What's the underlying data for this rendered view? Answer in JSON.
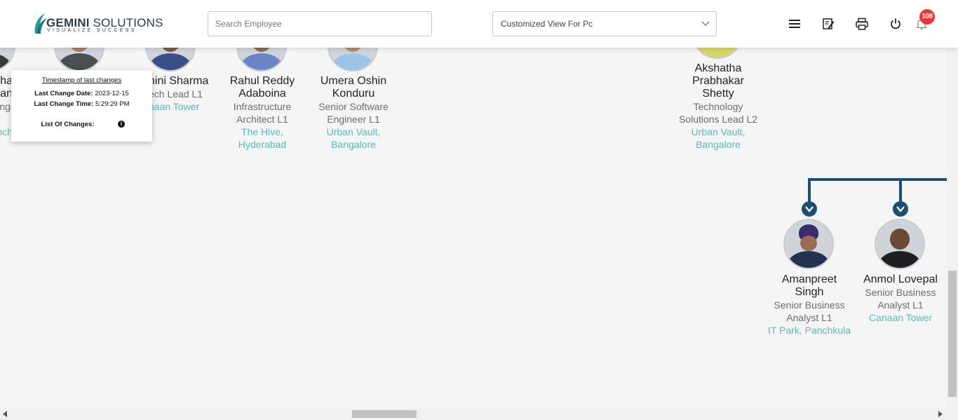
{
  "header": {
    "logo": {
      "brand_bold": "GEMINI",
      "brand_rest": " SOLUTIONS",
      "tagline": "VISUALIZE SUCCESS"
    },
    "search": {
      "placeholder": "Search Employee",
      "value": ""
    },
    "view_select": {
      "selected": "Customized View For Pc"
    },
    "icons": [
      "menu-icon",
      "edit-note-icon",
      "print-icon",
      "power-icon",
      "bell-icon"
    ],
    "notification_count": "108"
  },
  "tooltip": {
    "heading": "Timestamp of last changes",
    "date_label": "Last Change Date:",
    "date_value": "2023-12-15",
    "time_label": "Last Change Time:",
    "time_value": "5:29:29 PM",
    "changes_label": "List Of Changes:"
  },
  "partial_left": {
    "name_frag": "ha",
    "name_frag2": "an",
    "title_frag": "ngi",
    "loc_frag": "nch"
  },
  "employees": [
    {
      "name": "nini Sharma",
      "title1": "ech Lead L1",
      "loc1": "naan Tower"
    },
    {
      "name": "Rahul Reddy",
      "name2": "Adaboina",
      "title1": "Infrastructure",
      "title2": "Architect L1",
      "loc1": "The Hive,",
      "loc2": "Hyderabad"
    },
    {
      "name": "Umera Oshin",
      "name2": "Konduru",
      "title1": "Senior Software",
      "title2": "Engineer L1",
      "loc1": "Urban Vault,",
      "loc2": "Bangalore"
    },
    {
      "name": "Akshatha",
      "name2": "Prabhakar",
      "name3": "Shetty",
      "title1": "Technology",
      "title2": "Solutions Lead L2",
      "loc1": "Urban Vault,",
      "loc2": "Bangalore"
    },
    {
      "name": "Amanpreet",
      "name2": "Singh",
      "title1": "Senior Business",
      "title2": "Analyst L1",
      "loc1": "IT Park, Panchkula"
    },
    {
      "name": "Anmol Lovepal",
      "title1": "Senior Business",
      "title2": "Analyst L1",
      "loc1": "Canaan Tower"
    }
  ],
  "colors": {
    "accent": "#5ab7bd",
    "connector": "#1f4e70",
    "badge": "#e53935"
  }
}
